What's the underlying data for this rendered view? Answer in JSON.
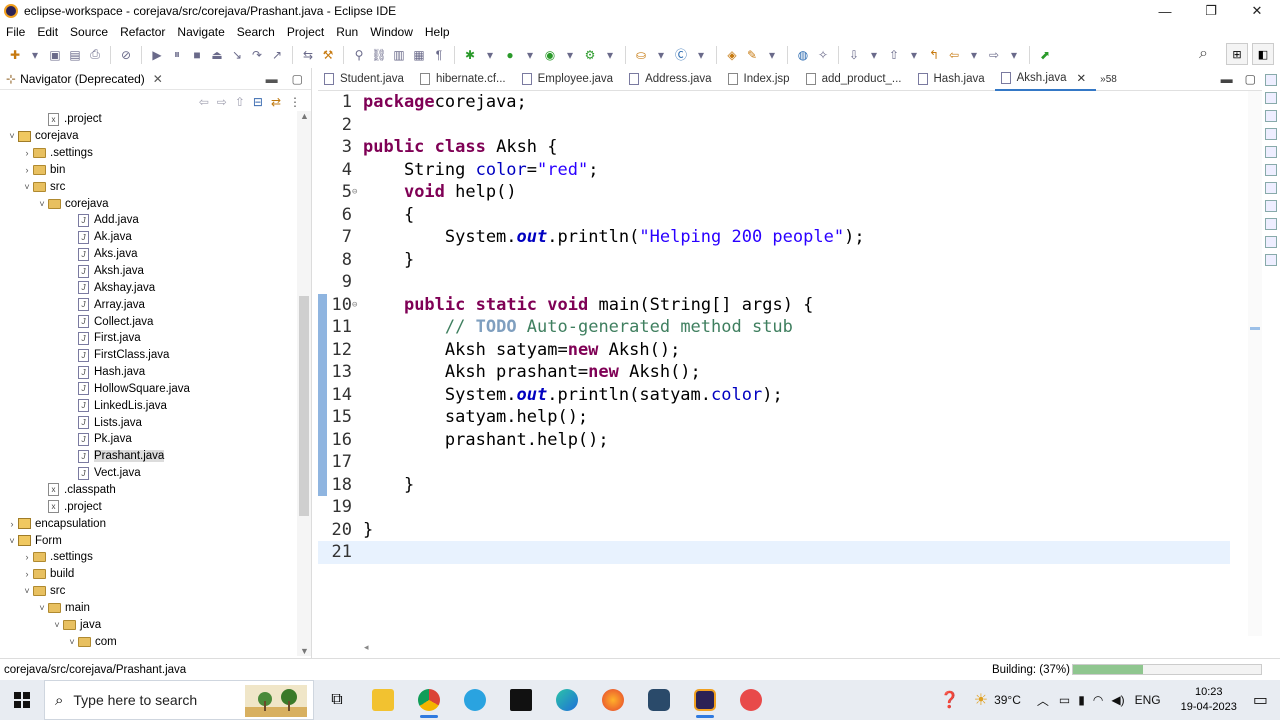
{
  "window": {
    "title": "eclipse-workspace - corejava/src/corejava/Prashant.java - Eclipse IDE"
  },
  "menu": [
    "File",
    "Edit",
    "Source",
    "Refactor",
    "Navigate",
    "Search",
    "Project",
    "Run",
    "Window",
    "Help"
  ],
  "navigator": {
    "title": "Navigator (Deprecated)",
    "items": [
      {
        "label": ".project",
        "type": "file",
        "indent": 2,
        "arrow": ""
      },
      {
        "label": "corejava",
        "type": "project",
        "indent": 0,
        "arrow": "˅"
      },
      {
        "label": ".settings",
        "type": "folder",
        "indent": 1,
        "arrow": "›"
      },
      {
        "label": "bin",
        "type": "folder",
        "indent": 1,
        "arrow": "›"
      },
      {
        "label": "src",
        "type": "folder",
        "indent": 1,
        "arrow": "˅"
      },
      {
        "label": "corejava",
        "type": "folder",
        "indent": 2,
        "arrow": "˅"
      },
      {
        "label": "Add.java",
        "type": "java",
        "indent": 4,
        "arrow": ""
      },
      {
        "label": "Ak.java",
        "type": "java",
        "indent": 4,
        "arrow": ""
      },
      {
        "label": "Aks.java",
        "type": "java",
        "indent": 4,
        "arrow": ""
      },
      {
        "label": "Aksh.java",
        "type": "java",
        "indent": 4,
        "arrow": ""
      },
      {
        "label": "Akshay.java",
        "type": "java",
        "indent": 4,
        "arrow": ""
      },
      {
        "label": "Array.java",
        "type": "java",
        "indent": 4,
        "arrow": ""
      },
      {
        "label": "Collect.java",
        "type": "java",
        "indent": 4,
        "arrow": ""
      },
      {
        "label": "First.java",
        "type": "java",
        "indent": 4,
        "arrow": ""
      },
      {
        "label": "FirstClass.java",
        "type": "java",
        "indent": 4,
        "arrow": ""
      },
      {
        "label": "Hash.java",
        "type": "java",
        "indent": 4,
        "arrow": ""
      },
      {
        "label": "HollowSquare.java",
        "type": "java",
        "indent": 4,
        "arrow": ""
      },
      {
        "label": "LinkedLis.java",
        "type": "java",
        "indent": 4,
        "arrow": ""
      },
      {
        "label": "Lists.java",
        "type": "java",
        "indent": 4,
        "arrow": ""
      },
      {
        "label": "Pk.java",
        "type": "java",
        "indent": 4,
        "arrow": ""
      },
      {
        "label": "Prashant.java",
        "type": "java",
        "indent": 4,
        "arrow": "",
        "selected": true
      },
      {
        "label": "Vect.java",
        "type": "java",
        "indent": 4,
        "arrow": ""
      },
      {
        "label": ".classpath",
        "type": "file",
        "indent": 2,
        "arrow": ""
      },
      {
        "label": ".project",
        "type": "file",
        "indent": 2,
        "arrow": ""
      },
      {
        "label": "encapsulation",
        "type": "project",
        "indent": 0,
        "arrow": "›"
      },
      {
        "label": "Form",
        "type": "project",
        "indent": 0,
        "arrow": "˅"
      },
      {
        "label": ".settings",
        "type": "folder",
        "indent": 1,
        "arrow": "›"
      },
      {
        "label": "build",
        "type": "folder",
        "indent": 1,
        "arrow": "›"
      },
      {
        "label": "src",
        "type": "folder",
        "indent": 1,
        "arrow": "˅"
      },
      {
        "label": "main",
        "type": "folder",
        "indent": 2,
        "arrow": "˅"
      },
      {
        "label": "java",
        "type": "folder",
        "indent": 3,
        "arrow": "˅"
      },
      {
        "label": "com",
        "type": "folder",
        "indent": 4,
        "arrow": "˅"
      }
    ]
  },
  "editor": {
    "tabs": [
      {
        "label": "Student.java"
      },
      {
        "label": "hibernate.cf..."
      },
      {
        "label": "Employee.java"
      },
      {
        "label": "Address.java"
      },
      {
        "label": "Index.jsp"
      },
      {
        "label": "add_product_..."
      },
      {
        "label": "Hash.java"
      },
      {
        "label": "Aksh.java",
        "active": true
      }
    ],
    "more_tabs": "»58",
    "lines": [
      {
        "n": "1",
        "fold": "",
        "html": [
          [
            "kw",
            "package"
          ],
          [
            "",
            "corejava;"
          ]
        ]
      },
      {
        "n": "2",
        "fold": "",
        "html": []
      },
      {
        "n": "3",
        "fold": "",
        "html": [
          [
            "kw",
            "public"
          ],
          [
            "",
            " "
          ],
          [
            "kw",
            "class"
          ],
          [
            "",
            " Aksh {"
          ]
        ]
      },
      {
        "n": "4",
        "fold": "",
        "html": [
          [
            "",
            "    String "
          ],
          [
            "fld",
            "color"
          ],
          [
            "",
            "="
          ],
          [
            "str",
            "\"red\""
          ],
          [
            "",
            ";"
          ]
        ]
      },
      {
        "n": "5",
        "fold": "⊖",
        "html": [
          [
            "",
            "    "
          ],
          [
            "kw",
            "void"
          ],
          [
            "",
            " help()"
          ]
        ]
      },
      {
        "n": "6",
        "fold": "",
        "html": [
          [
            "",
            "    {"
          ]
        ]
      },
      {
        "n": "7",
        "fold": "",
        "html": [
          [
            "",
            "        System."
          ],
          [
            "sfld",
            "out"
          ],
          [
            "",
            ".println("
          ],
          [
            "str",
            "\"Helping 200 people\""
          ],
          [
            "",
            ");"
          ]
        ]
      },
      {
        "n": "8",
        "fold": "",
        "html": [
          [
            "",
            "    }"
          ]
        ]
      },
      {
        "n": "9",
        "fold": "",
        "html": []
      },
      {
        "n": "10",
        "fold": "⊖",
        "html": [
          [
            "",
            "    "
          ],
          [
            "kw",
            "public"
          ],
          [
            "",
            " "
          ],
          [
            "kw",
            "static"
          ],
          [
            "",
            " "
          ],
          [
            "kw",
            "void"
          ],
          [
            "",
            " main(String[] args) {"
          ]
        ]
      },
      {
        "n": "11",
        "fold": "",
        "html": [
          [
            "",
            "        "
          ],
          [
            "cm",
            "// "
          ],
          [
            "tk",
            "TODO"
          ],
          [
            "cm",
            " Auto-generated method stub"
          ]
        ]
      },
      {
        "n": "12",
        "fold": "",
        "html": [
          [
            "",
            "        Aksh satyam="
          ],
          [
            "kw",
            "new"
          ],
          [
            "",
            " Aksh();"
          ]
        ]
      },
      {
        "n": "13",
        "fold": "",
        "html": [
          [
            "",
            "        Aksh prashant="
          ],
          [
            "kw",
            "new"
          ],
          [
            "",
            " Aksh();"
          ]
        ]
      },
      {
        "n": "14",
        "fold": "",
        "html": [
          [
            "",
            "        System."
          ],
          [
            "sfld",
            "out"
          ],
          [
            "",
            ".println(satyam."
          ],
          [
            "fld",
            "color"
          ],
          [
            "",
            ");"
          ]
        ]
      },
      {
        "n": "15",
        "fold": "",
        "html": [
          [
            "",
            "        satyam.help();"
          ]
        ]
      },
      {
        "n": "16",
        "fold": "",
        "html": [
          [
            "",
            "        prashant.help();"
          ]
        ]
      },
      {
        "n": "17",
        "fold": "",
        "html": []
      },
      {
        "n": "18",
        "fold": "",
        "html": [
          [
            "",
            "    }"
          ]
        ]
      },
      {
        "n": "19",
        "fold": "",
        "html": []
      },
      {
        "n": "20",
        "fold": "",
        "html": [
          [
            "",
            "}"
          ]
        ]
      },
      {
        "n": "21",
        "fold": "",
        "html": [],
        "current": true
      }
    ]
  },
  "status": {
    "path": "corejava/src/corejava/Prashant.java",
    "build": "Building: (37%)",
    "progress": 0.37
  },
  "taskbar": {
    "search_placeholder": "Type here to search",
    "weather": "39°C",
    "lang": "ENG",
    "time": "10:23",
    "date": "19-04-2023"
  },
  "colors": {
    "keyword": "#7f0055",
    "string": "#2a00ff",
    "comment": "#3f7f5f",
    "field": "#0000c0",
    "accent": "#3478c6"
  }
}
